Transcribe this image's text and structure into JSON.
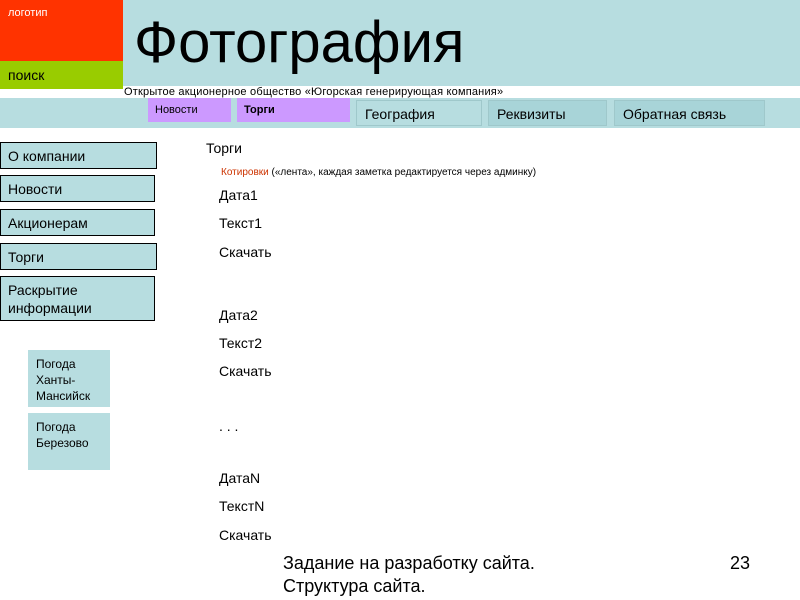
{
  "header": {
    "logo": "логотип",
    "search": "поиск",
    "title": "Фотография",
    "company": "Открытое акционерное общество «Югорская генерирующая компания»"
  },
  "nav": [
    {
      "label": "Новости"
    },
    {
      "label": "Торги"
    },
    {
      "label": "География"
    },
    {
      "label": "Реквизиты"
    },
    {
      "label": "Обратная связь"
    }
  ],
  "sidebar": [
    {
      "label": "О компании"
    },
    {
      "label": "Новости"
    },
    {
      "label": "Акционерам"
    },
    {
      "label": "Торги"
    },
    {
      "label": "Раскрытие информации"
    }
  ],
  "weather": [
    {
      "label": "Погода Ханты-Мансийск"
    },
    {
      "label": "Погода Березово"
    }
  ],
  "content": {
    "heading": "Торги",
    "quotes_link": "Котировки",
    "quotes_note": "(«лента», каждая заметка редактируется через админку)",
    "entries": [
      {
        "date": "Дата1",
        "text": "Текст1",
        "download": "Скачать"
      },
      {
        "date": "Дата2",
        "text": "Текст2",
        "download": "Скачать"
      },
      {
        "date": "ДатаN",
        "text": "ТекстN",
        "download": "Скачать"
      }
    ],
    "ellipsis": ". . ."
  },
  "footer": {
    "text": "Задание на разработку сайта. Структура сайта.",
    "page": "23"
  }
}
